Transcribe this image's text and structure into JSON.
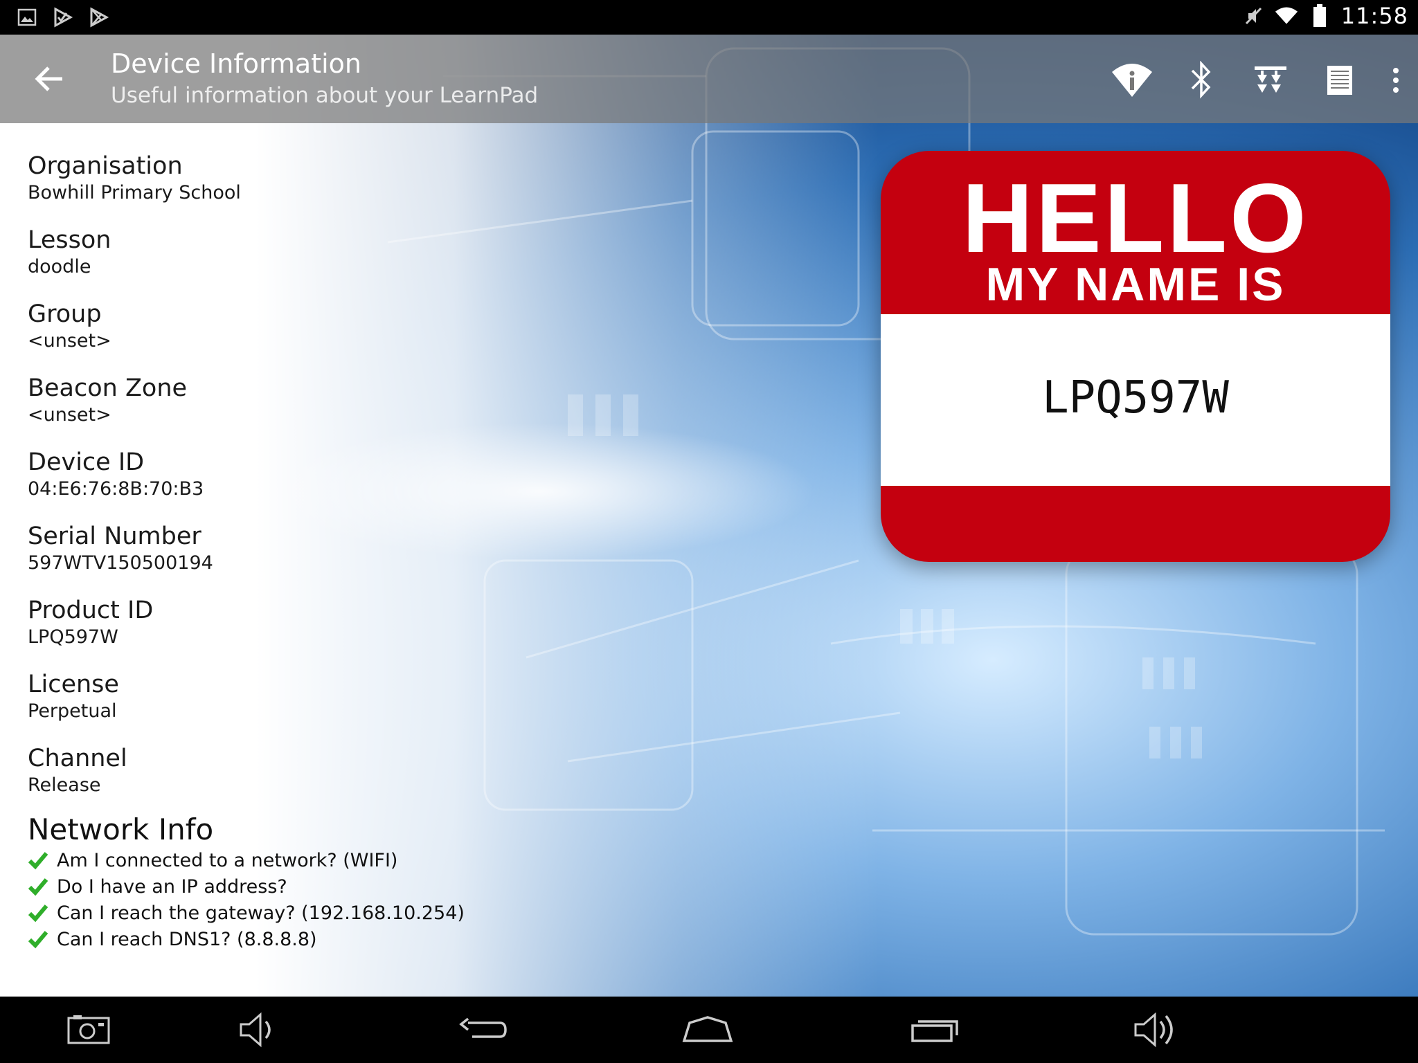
{
  "status_bar": {
    "time": "11:58",
    "left_icons": [
      "image-icon",
      "play-store-check-icon",
      "play-store-icon"
    ],
    "right_icons": [
      "mute-icon",
      "wifi-icon",
      "battery-icon"
    ]
  },
  "action_bar": {
    "title": "Device Information",
    "subtitle": "Useful information about your LearnPad",
    "icons": [
      "wifi-info-icon",
      "bluetooth-icon",
      "download-icon",
      "log-icon",
      "overflow-menu-icon"
    ]
  },
  "fields": [
    {
      "label": "Organisation",
      "value": "Bowhill Primary School"
    },
    {
      "label": "Lesson",
      "value": "doodle"
    },
    {
      "label": "Group",
      "value": "<unset>"
    },
    {
      "label": "Beacon Zone",
      "value": "<unset>"
    },
    {
      "label": "Device ID",
      "value": "04:E6:76:8B:70:B3"
    },
    {
      "label": "Serial Number",
      "value": "597WTV150500194"
    },
    {
      "label": "Product ID",
      "value": "LPQ597W"
    },
    {
      "label": "License",
      "value": "Perpetual"
    },
    {
      "label": "Channel",
      "value": "Release"
    }
  ],
  "network": {
    "title": "Network Info",
    "checks": [
      "Am I connected to a network? (WIFI)",
      "Do I have an IP address?",
      "Can I reach the gateway? (192.168.10.254)",
      "Can I reach DNS1? (8.8.8.8)"
    ]
  },
  "badge": {
    "hello": "HELLO",
    "my_name_is": "MY NAME IS",
    "name": "LPQ597W",
    "color": "#c4000f"
  },
  "nav_bar": {
    "icons": [
      "screenshot-icon",
      "volume-down-icon",
      "back-icon",
      "home-icon",
      "recents-icon",
      "volume-up-icon"
    ]
  }
}
